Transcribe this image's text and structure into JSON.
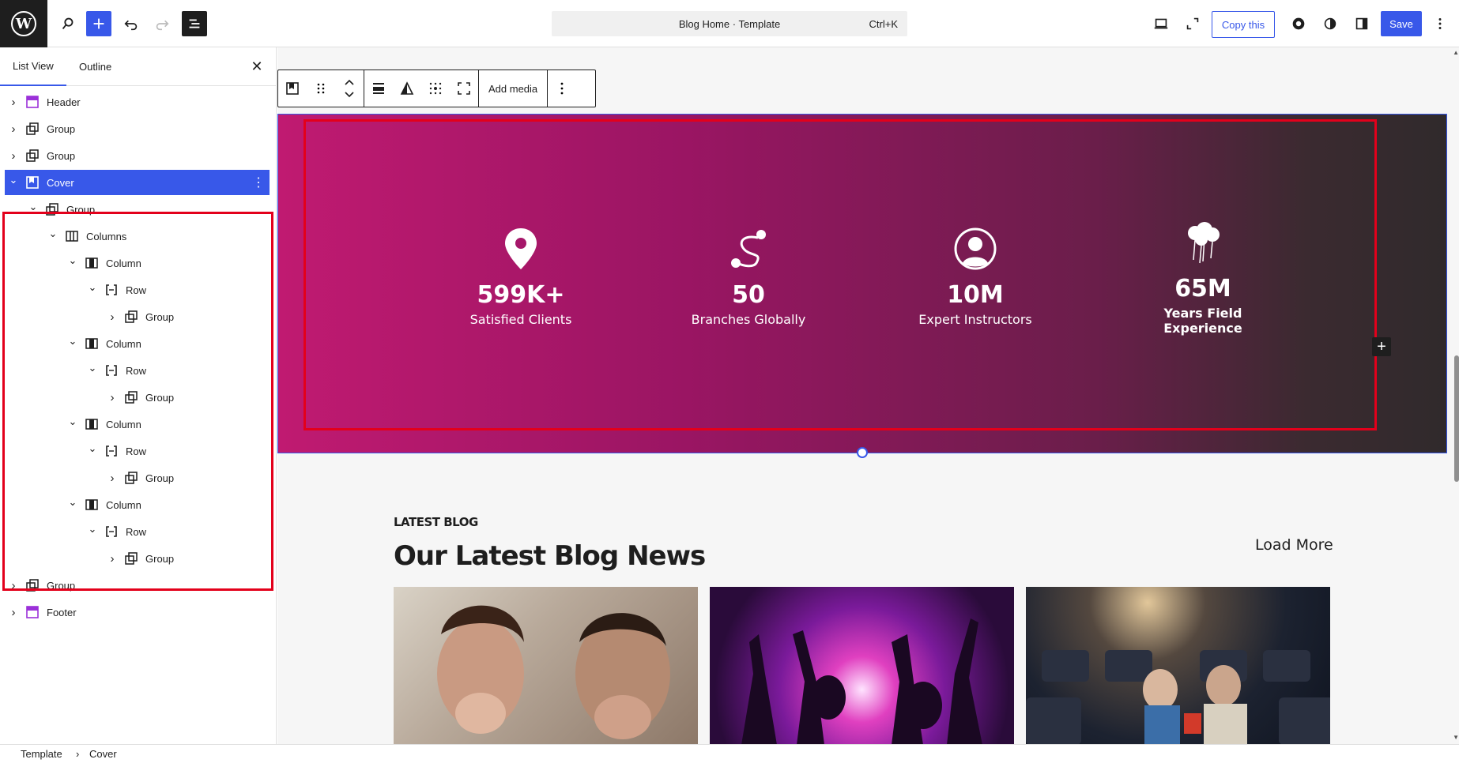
{
  "topbar": {
    "command_title": "Blog Home · Template",
    "command_shortcut": "Ctrl+K",
    "copy_label": "Copy this",
    "save_label": "Save"
  },
  "sidebar": {
    "tabs": [
      "List View",
      "Outline"
    ],
    "close_symbol": "✕",
    "items": [
      {
        "label": "Header",
        "icon": "template-part-icon",
        "depth": 0
      },
      {
        "label": "Group",
        "icon": "group-icon",
        "depth": 0
      },
      {
        "label": "Group",
        "icon": "group-icon",
        "depth": 0
      },
      {
        "label": "Cover",
        "icon": "cover-icon",
        "depth": 0,
        "selected": true
      },
      {
        "label": "Group",
        "icon": "group-icon",
        "depth": 1
      },
      {
        "label": "Columns",
        "icon": "columns-icon",
        "depth": 2
      },
      {
        "label": "Column",
        "icon": "column-icon",
        "depth": 3
      },
      {
        "label": "Row",
        "icon": "row-icon",
        "depth": 4
      },
      {
        "label": "Group",
        "icon": "group-icon",
        "depth": 5
      },
      {
        "label": "Column",
        "icon": "column-icon",
        "depth": 3
      },
      {
        "label": "Row",
        "icon": "row-icon",
        "depth": 4
      },
      {
        "label": "Group",
        "icon": "group-icon",
        "depth": 5
      },
      {
        "label": "Column",
        "icon": "column-icon",
        "depth": 3
      },
      {
        "label": "Row",
        "icon": "row-icon",
        "depth": 4
      },
      {
        "label": "Group",
        "icon": "group-icon",
        "depth": 5
      },
      {
        "label": "Column",
        "icon": "column-icon",
        "depth": 3
      },
      {
        "label": "Row",
        "icon": "row-icon",
        "depth": 4
      },
      {
        "label": "Group",
        "icon": "group-icon",
        "depth": 5
      },
      {
        "label": "Group",
        "icon": "group-icon",
        "depth": 0
      },
      {
        "label": "Footer",
        "icon": "template-part-icon",
        "depth": 0
      }
    ]
  },
  "toolbar": {
    "add_media_label": "Add media"
  },
  "cover": {
    "stats": [
      {
        "number": "599K+",
        "label": "Satisfied Clients",
        "icon": "location-pin-icon"
      },
      {
        "number": "50",
        "label": "Branches Globally",
        "icon": "route-icon"
      },
      {
        "number": "10M",
        "label": "Expert Instructors",
        "icon": "user-circle-icon"
      },
      {
        "number": "65M",
        "label": "Years Field Experience",
        "icon": "balloons-icon"
      }
    ]
  },
  "blog": {
    "eyebrow": "LATEST BLOG",
    "title": "Our Latest Blog News",
    "load_more": "Load More"
  },
  "breadcrumb": [
    "Template",
    "Cover"
  ],
  "colors": {
    "accent": "#3858e9",
    "highlight": "#e3001b",
    "cover_start": "#c01a71",
    "cover_end": "#302a2c"
  }
}
